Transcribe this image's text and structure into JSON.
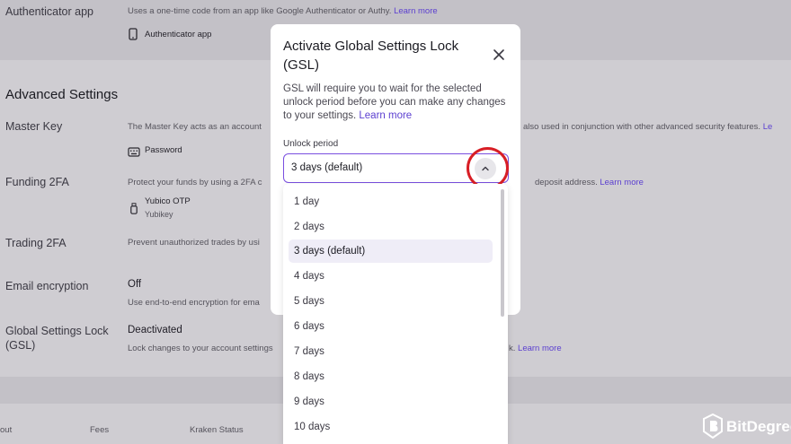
{
  "background": {
    "authenticator": {
      "label": "Authenticator app",
      "desc_prefix": "Uses a one-time code from an app like Google Authenticator or Authy.",
      "desc_link": "Learn more",
      "device": "Authenticator app"
    },
    "advanced_title": "Advanced Settings",
    "master_key": {
      "label": "Master Key",
      "desc_left": "The Master Key acts as an account",
      "desc_right": "also used in conjunction with other advanced security features.",
      "desc_right_link": "Le",
      "method": "Password"
    },
    "funding_2fa": {
      "label": "Funding 2FA",
      "desc_left": "Protect your funds by using a 2FA c",
      "desc_right": "deposit address.",
      "desc_right_link": "Learn more",
      "method": "Yubico OTP",
      "method_sub": "Yubikey"
    },
    "trading_2fa": {
      "label": "Trading 2FA",
      "desc_left": "Prevent unauthorized trades by usi"
    },
    "email_encryption": {
      "label": "Email encryption",
      "value": "Off",
      "desc_left": "Use end-to-end encryption for ema"
    },
    "gsl": {
      "label_line1": "Global Settings Lock",
      "label_line2": "(GSL)",
      "value": "Deactivated",
      "desc_left": "Lock changes to your account settings",
      "desc_right": "k.",
      "desc_right_link": "Learn more"
    },
    "footer": [
      "out",
      "Fees",
      "Kraken Status"
    ]
  },
  "modal": {
    "title": "Activate Global Settings Lock (GSL)",
    "desc": "GSL will require you to wait for the selected unlock period before you can make any changes to your settings.",
    "desc_link": "Learn more",
    "unlock_label": "Unlock period",
    "selected_value": "3 days (default)",
    "options": [
      "1 day",
      "2 days",
      "3 days (default)",
      "4 days",
      "5 days",
      "6 days",
      "7 days",
      "8 days",
      "9 days",
      "10 days"
    ],
    "selected_index": 2
  },
  "watermark": {
    "text": "BitDegree"
  },
  "colors": {
    "accent": "#7a4fe0",
    "link": "#5b3fd0",
    "highlight_ring": "#d81e25",
    "selected_bg": "#efedf7"
  },
  "icons": {
    "authenticator": "phone-icon",
    "password": "keyboard-icon",
    "yubikey": "usb-key-icon",
    "close": "close-icon",
    "dropdown": "chevron-up-icon",
    "watermark": "bitdegree-logo-icon"
  }
}
